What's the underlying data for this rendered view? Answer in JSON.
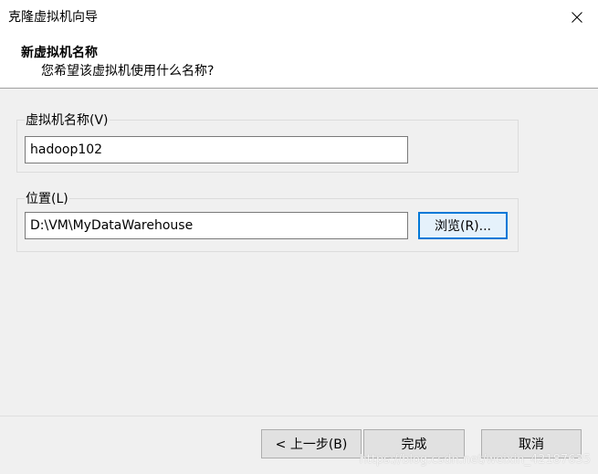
{
  "window": {
    "title": "克隆虚拟机向导"
  },
  "header": {
    "title": "新虚拟机名称",
    "subtitle": "您希望该虚拟机使用什么名称?"
  },
  "name_group": {
    "label": "虚拟机名称(V)",
    "value": "hadoop102"
  },
  "location_group": {
    "label": "位置(L)",
    "value": "D:\\VM\\MyDataWarehouse",
    "browse_label": "浏览(R)..."
  },
  "footer": {
    "back_label": "< 上一步(B)",
    "finish_label": "完成",
    "cancel_label": "取消"
  },
  "watermark": "https://blog.csdn.net/weixin_42187635",
  "colors": {
    "focus_border": "#0078d7",
    "background": "#f0f0f0",
    "header_background": "#ffffff"
  },
  "icons": {
    "close": "close-icon"
  }
}
